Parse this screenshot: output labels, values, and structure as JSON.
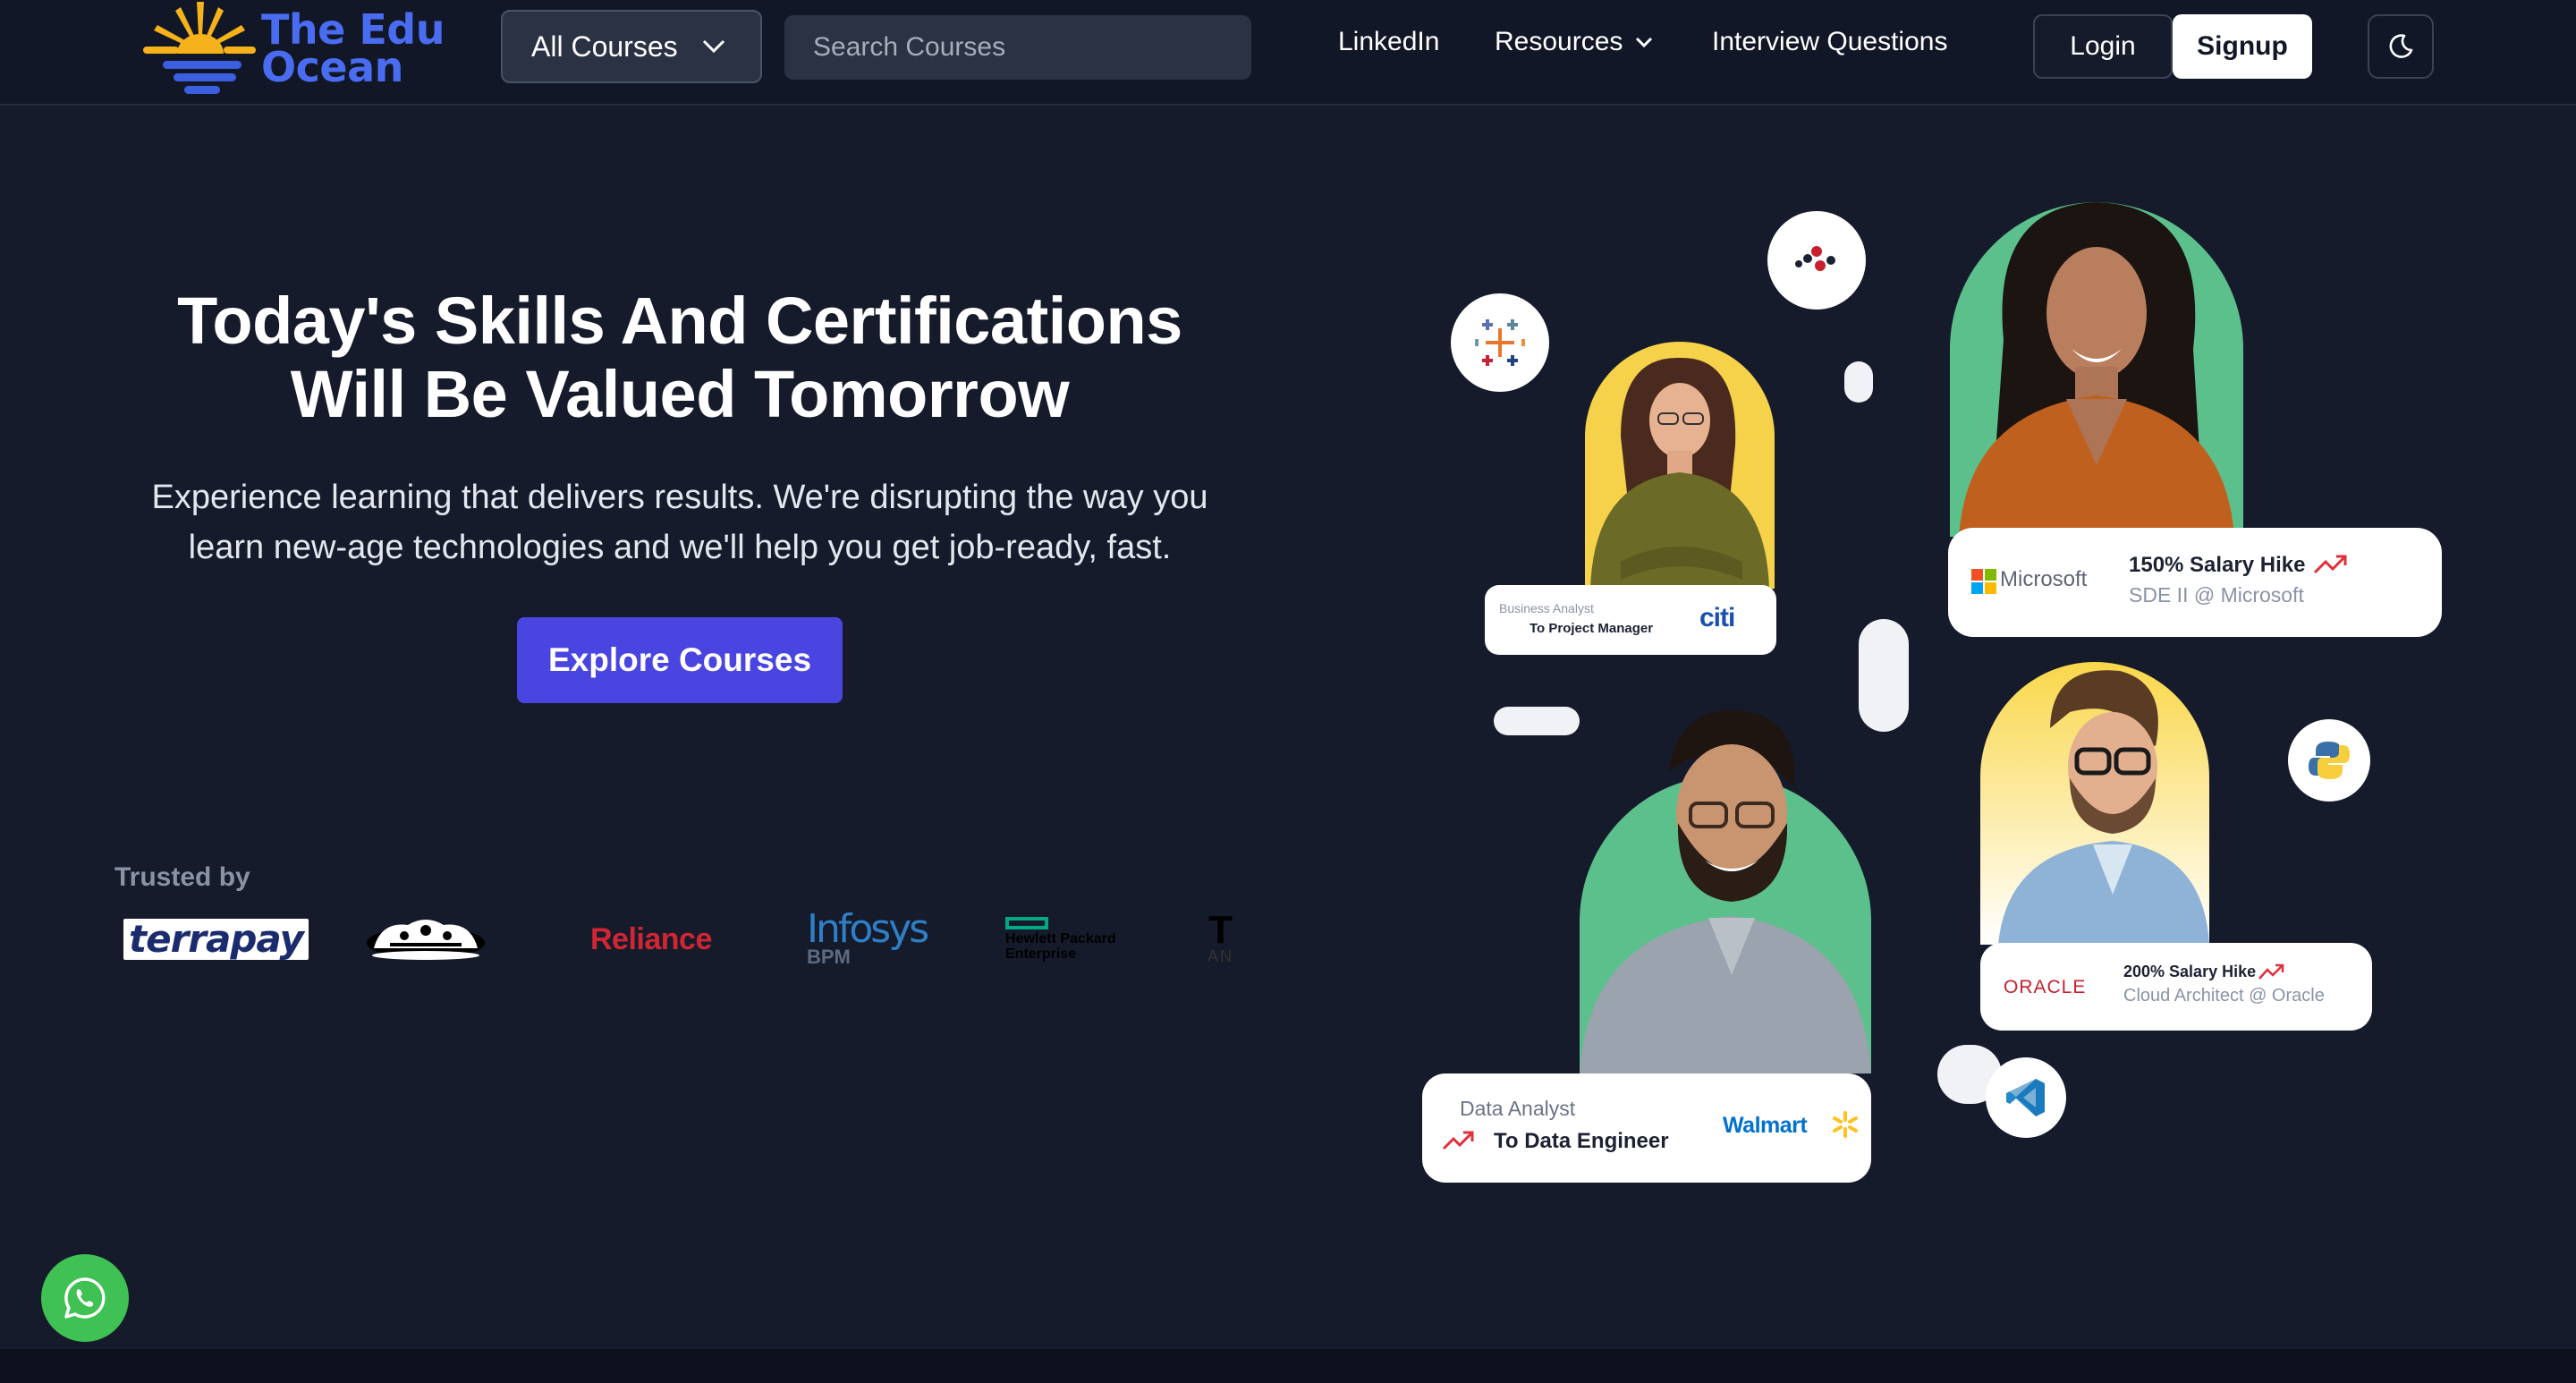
{
  "brand": {
    "name": "The Edu Ocean",
    "line1": "The Edu",
    "line2": "Ocean"
  },
  "header": {
    "all_courses": "All Courses",
    "search_placeholder": "Search Courses",
    "nav": {
      "linkedin": "LinkedIn",
      "resources": "Resources",
      "interview": "Interview Questions"
    },
    "login": "Login",
    "signup": "Signup",
    "theme_icon": "moon-icon"
  },
  "hero": {
    "title": "Today's Skills And Certifications Will Be Valued Tomorrow",
    "subtitle": "Experience learning that delivers results. We're disrupting the way you learn new-age technologies and we'll help you get job-ready, fast.",
    "cta": "Explore Courses"
  },
  "trusted": {
    "label": "Trusted by",
    "logos": {
      "terrapay": "terrapay",
      "reliance": "Reliance",
      "infosys": "Infosys",
      "infosys_sub": "BPM",
      "hpe_line1": "Hewlett Packard",
      "hpe_line2": "Enterprise",
      "an_big": "T",
      "an_small": "AN"
    }
  },
  "cards": {
    "citi": {
      "from": "Business Analyst",
      "to": "To Project Manager",
      "company": "citi"
    },
    "microsoft": {
      "company": "Microsoft",
      "hike": "150% Salary Hike",
      "role": "SDE II @ Microsoft"
    },
    "oracle": {
      "company": "ORACLE",
      "hike": "200% Salary Hike",
      "role": "Cloud Architect @ Oracle"
    },
    "walmart": {
      "from": "Data Analyst",
      "to": "To Data Engineer",
      "company": "Walmart"
    }
  },
  "floating_icons": [
    "tableau-icon",
    "dots-logo-icon",
    "python-icon",
    "vscode-icon"
  ],
  "whatsapp_icon": "whatsapp-icon",
  "colors": {
    "background": "#151b2b",
    "header": "#111726",
    "accent": "#4a45e0",
    "brand_blue": "#4a6cf0",
    "brand_orange": "#f6b21a",
    "whatsapp": "#3fc153"
  }
}
